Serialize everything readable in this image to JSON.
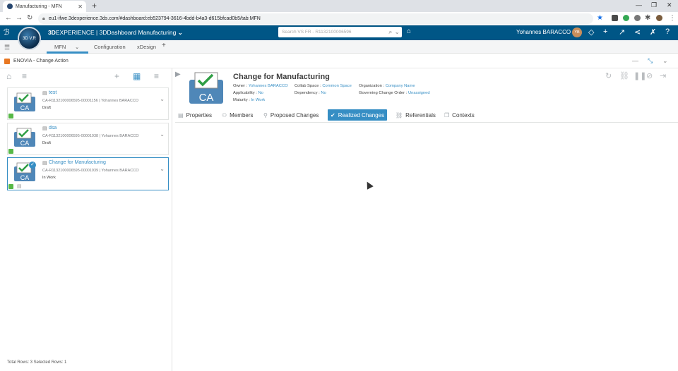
{
  "browser": {
    "tab_title": "Manufacturing - MFN",
    "url": "eu1-ifwe.3dexperience.3ds.com/#dashboard:eb523794-3616-4bdd-b4a3-d615bfcad0b5/tab:MFN"
  },
  "topbar": {
    "brand_3d": "3D",
    "brand_experience": "EXPERIENCE | 3DDashboard",
    "brand_app": "Manufacturing",
    "search_placeholder": "Search VS FR - R1132100006596",
    "user_name": "Yohannes BARACCO",
    "user_initials": "YB",
    "compass_label": "3D V,R"
  },
  "dashboard_tabs": [
    "MFN",
    "Configuration",
    "xDesign"
  ],
  "widget": {
    "title": "ENOVIA - Change Action"
  },
  "list": {
    "items": [
      {
        "name": "test",
        "meta": "CA-R1132100006595-00001156 | Yohannes BARACCO",
        "state": "Draft"
      },
      {
        "name": "dsa",
        "meta": "CA-R1132100006595-00001938 | Yohannes BARACCO",
        "state": "Draft"
      },
      {
        "name": "Change for Manufacturing",
        "meta": "CA-R1132100006595-00001939 | Yohannes BARACCO",
        "state": "In Work"
      }
    ],
    "footer": "Total Rows: 3    Selected Rows: 1"
  },
  "detail": {
    "badge": "CA",
    "title": "Change for Manufacturing",
    "owner_label": "Owner : ",
    "owner": "Yohannes BARACCO",
    "collab_label": "Collab Space : ",
    "collab": "Common Space",
    "org_label": "Organization : ",
    "org": "Company Name",
    "applic_label": "Applicability : ",
    "applic": "No",
    "dep_label": "Dependency : ",
    "dep": "No",
    "gov_label": "Governing Change Order : ",
    "gov": "Unassigned",
    "maturity_label": "Maturity : ",
    "maturity": "In Work",
    "tabs": [
      "Properties",
      "Members",
      "Proposed Changes",
      "Realized Changes",
      "Referentials",
      "Contexts"
    ],
    "active_tab": "Realized Changes"
  },
  "colors": {
    "accent": "#368ec4",
    "topbar": "#005686",
    "approved": "#57b847"
  }
}
